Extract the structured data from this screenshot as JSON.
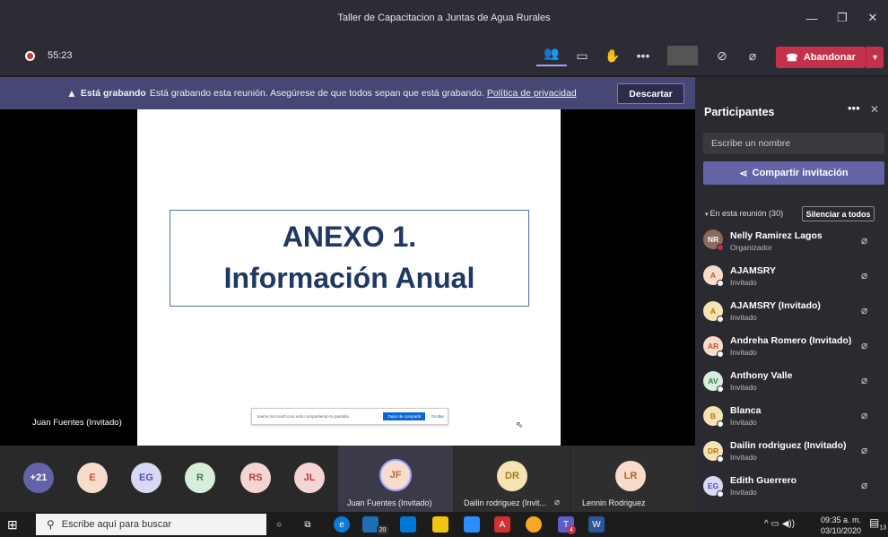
{
  "window": {
    "title": "Taller de Capacitacion a Juntas de Agua Rurales"
  },
  "toolbar": {
    "timer": "55:23",
    "leave_label": "Abandonar",
    "icons": [
      "people-icon",
      "chat-icon",
      "raise-hand-icon",
      "more-icon",
      "camera-off-icon",
      "mic-off-icon",
      "share-icon"
    ]
  },
  "banner": {
    "title": "Está grabando",
    "message": "Está grabando esta reunión. Asegúrese de que todos sepan que está grabando.",
    "link": "Política de privacidad",
    "dismiss_label": "Descartar"
  },
  "slide": {
    "line1": "ANEXO 1.",
    "line2": "Información Anual"
  },
  "share_bar": {
    "message": "teams.microsoft.com está compartiendo tu pantalla.",
    "stop_label": "Dejar de compartir",
    "hide_label": "Ocultar"
  },
  "presenter_name": "Juan Fuentes (Invitado)",
  "strip": {
    "overflow": "+21",
    "avatars": [
      {
        "initials": "E",
        "color": "#f7dccb",
        "text": "#c05a2a"
      },
      {
        "initials": "EG",
        "color": "#d9d9f3",
        "text": "#4f52b2"
      },
      {
        "initials": "R",
        "color": "#d7eedc",
        "text": "#3e7a4a"
      },
      {
        "initials": "RS",
        "color": "#f5d4d4",
        "text": "#b33a3a"
      },
      {
        "initials": "JL",
        "color": "#f5d4d4",
        "text": "#b33a3a"
      }
    ],
    "tiles": [
      {
        "initials": "JF",
        "name": "Juan Fuentes (Invitado)"
      },
      {
        "initials": "DR",
        "name": "Dailin rodriguez (Invit..."
      },
      {
        "initials": "LR",
        "name": "Lennin Rodriguez"
      }
    ]
  },
  "panel": {
    "title": "Participantes",
    "search_placeholder": "Escribe un nombre",
    "invite_label": "Compartir invitación",
    "section_label": "En esta reunión (30)",
    "mute_all_label": "Silenciar a todos",
    "participants": [
      {
        "initials": "NR",
        "name": "Nelly Ramirez Lagos",
        "role": "Organizador"
      },
      {
        "initials": "A",
        "name": "AJAMSRY",
        "role": "Invitado"
      },
      {
        "initials": "A",
        "name": "AJAMSRY (Invitado)",
        "role": "Invitado"
      },
      {
        "initials": "AR",
        "name": "Andreha Romero (Invitado)",
        "role": "Invitado"
      },
      {
        "initials": "AV",
        "name": "Anthony Valle",
        "role": "Invitado"
      },
      {
        "initials": "B",
        "name": "Blanca",
        "role": "Invitado"
      },
      {
        "initials": "DR",
        "name": "Dailin rodriguez (Invitado)",
        "role": "Invitado"
      },
      {
        "initials": "EG",
        "name": "Edith Guerrero",
        "role": "Invitado"
      }
    ]
  },
  "taskbar": {
    "search_placeholder": "Escribe aquí para buscar",
    "time": "09:35 a. m.",
    "date": "03/10/2020",
    "notif_count": "13",
    "badge_store": "20",
    "badge_teams": "4"
  },
  "colors": {
    "accent": "#6264a7",
    "leave": "#c4314b",
    "banner": "#464775"
  }
}
